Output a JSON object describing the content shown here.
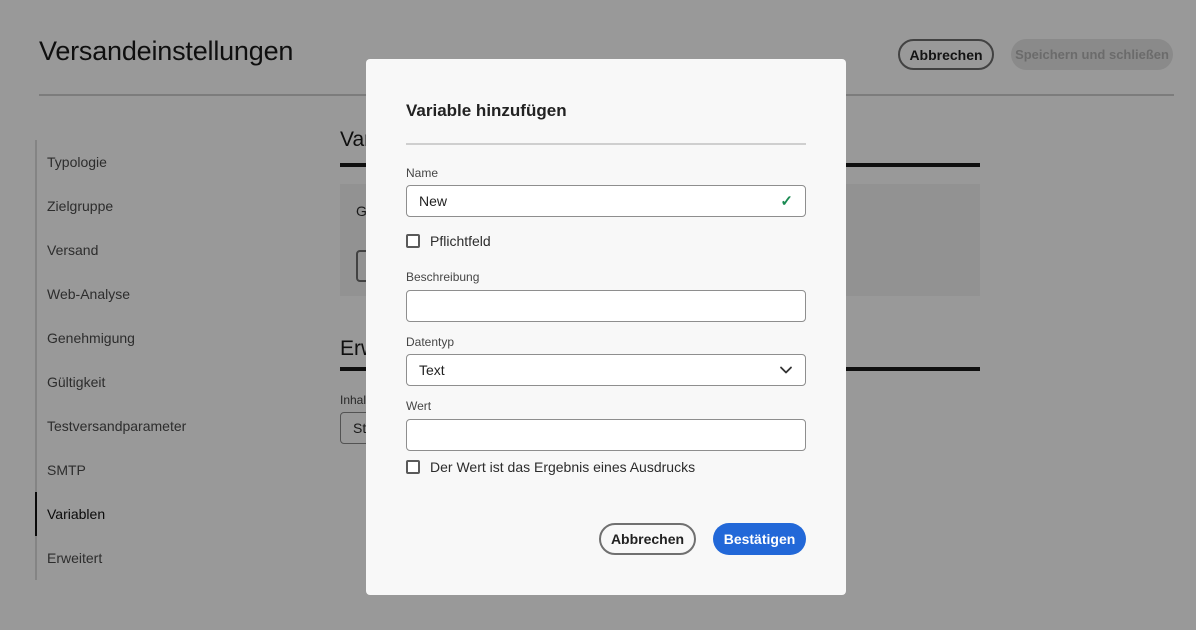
{
  "header": {
    "title": "Versandeinstellungen",
    "cancel_label": "Abbrechen",
    "save_label": "Speichern und schließen"
  },
  "sidebar": {
    "items": [
      {
        "label": "Typologie"
      },
      {
        "label": "Zielgruppe"
      },
      {
        "label": "Versand"
      },
      {
        "label": "Web-Analyse"
      },
      {
        "label": "Genehmigung"
      },
      {
        "label": "Gültigkeit"
      },
      {
        "label": "Testversandparameter"
      },
      {
        "label": "SMTP"
      },
      {
        "label": "Variablen",
        "active": true
      },
      {
        "label": "Erweitert"
      }
    ]
  },
  "main": {
    "section1_title": "Var",
    "panel_text": "Ge                                                                                                     s Versands konstant bl",
    "section2_title": "Erw",
    "content_label": "Inhal",
    "content_value": "Sta"
  },
  "dialog": {
    "title": "Variable hinzufügen",
    "name_label": "Name",
    "name_value": "New",
    "required_label": "Pflichtfeld",
    "description_label": "Beschreibung",
    "description_value": "",
    "datatype_label": "Datentyp",
    "datatype_value": "Text",
    "value_label": "Wert",
    "value_value": "",
    "expression_label": "Der Wert ist das Ergebnis eines Ausdrucks",
    "cancel_label": "Abbrechen",
    "confirm_label": "Bestätigen"
  },
  "icons": {
    "valid": "checkmark-icon",
    "dropdown": "chevron-down-icon"
  },
  "colors": {
    "accent": "#2268d8",
    "valid": "#1a8a52",
    "overlay": "rgba(0,0,0,0.4)"
  }
}
